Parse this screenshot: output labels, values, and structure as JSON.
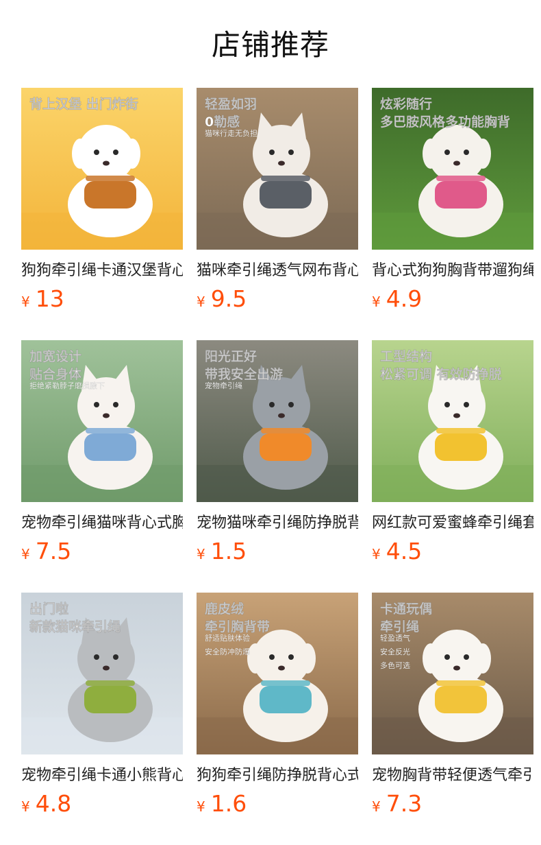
{
  "header": {
    "title": "店铺推荐"
  },
  "accent": "#ff4e0a",
  "products": [
    {
      "title": "狗狗牵引绳卡通汉堡背心式",
      "currency": "¥",
      "price": "13",
      "image": {
        "subject": "dog",
        "overlay": [
          "背上汉堡 出门炸街"
        ]
      },
      "palette": [
        "#f3b43a",
        "#fbd46a",
        "#ffffff",
        "#c9762a"
      ]
    },
    {
      "title": "猫咪牵引绳透气网布背心式",
      "currency": "¥",
      "price": "9.5",
      "image": {
        "subject": "cat",
        "overlay": [
          "轻盈如羽",
          "0勒感",
          "猫咪行走无负担"
        ]
      },
      "palette": [
        "#7c6a55",
        "#a88c6c",
        "#f1ece6",
        "#5a5f66"
      ]
    },
    {
      "title": "背心式狗狗胸背带遛狗绳",
      "currency": "¥",
      "price": "4.9",
      "image": {
        "subject": "dog",
        "overlay": [
          "炫彩随行",
          "多巴胺风格多功能胸背"
        ]
      },
      "palette": [
        "#5f9a3c",
        "#3e6b2a",
        "#f5f2ec",
        "#e05a8a"
      ]
    },
    {
      "title": "宠物牵引绳猫咪背心式胸背",
      "currency": "¥",
      "price": "7.5",
      "image": {
        "subject": "cat",
        "overlay": [
          "加宽设计",
          "贴合身体",
          "拒绝紧勒脖子磨损腋下"
        ]
      },
      "palette": [
        "#6f9a6a",
        "#a0c29a",
        "#f7f3ef",
        "#7faad6"
      ]
    },
    {
      "title": "宠物猫咪牵引绳防挣脱背心",
      "currency": "¥",
      "price": "1.5",
      "image": {
        "subject": "cat",
        "overlay": [
          "阳光正好",
          "带我安全出游",
          "宠物牵引绳"
        ]
      },
      "palette": [
        "#4f5a4a",
        "#8c8a80",
        "#9aa0a6",
        "#f08a2a"
      ]
    },
    {
      "title": "网红款可爱蜜蜂牵引绳套装",
      "currency": "¥",
      "price": "4.5",
      "image": {
        "subject": "cat",
        "overlay": [
          "工型结构",
          "松紧可调 有效防挣脱"
        ]
      },
      "palette": [
        "#7fae5a",
        "#b8d48e",
        "#f8f6f2",
        "#f2c230"
      ]
    },
    {
      "title": "宠物牵引绳卡通小熊背心式",
      "currency": "¥",
      "price": "4.8",
      "image": {
        "subject": "cat",
        "overlay": [
          "出门啦",
          "新款猫咪牵引绳"
        ]
      },
      "palette": [
        "#dfe6ec",
        "#c9d2da",
        "#b9bcbf",
        "#8fae3e"
      ]
    },
    {
      "title": "狗狗牵引绳防挣脱背心式",
      "currency": "¥",
      "price": "1.6",
      "image": {
        "subject": "dog",
        "overlay": [
          "鹿皮绒",
          "牵引胸背带",
          "舒适贴肤体验",
          "安全防冲防爆"
        ]
      },
      "palette": [
        "#8a6a4a",
        "#c8a277",
        "#f6f1ea",
        "#5fb8c8"
      ]
    },
    {
      "title": "宠物胸背带轻便透气牵引绳",
      "currency": "¥",
      "price": "7.3",
      "image": {
        "subject": "dog",
        "overlay": [
          "卡通玩偶",
          "牵引绳",
          "轻盈透气",
          "安全反光",
          "多色可选"
        ]
      },
      "palette": [
        "#6b5a48",
        "#a88b6a",
        "#f8f5f0",
        "#f2c43a"
      ]
    }
  ]
}
